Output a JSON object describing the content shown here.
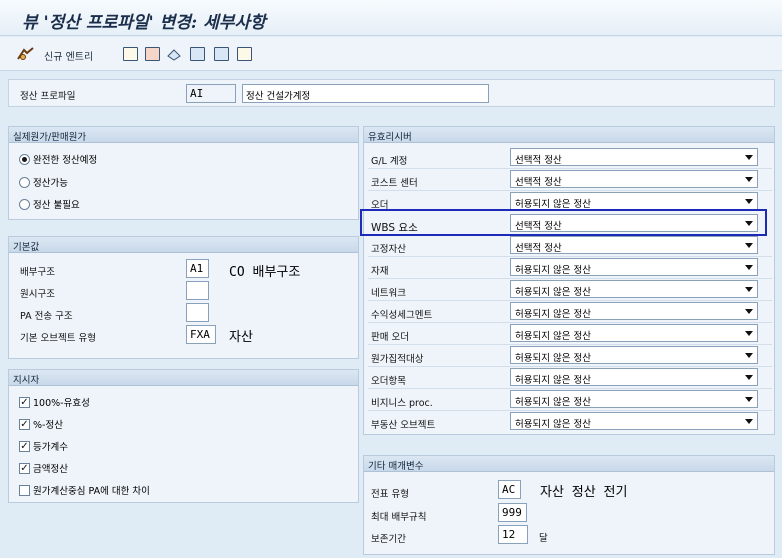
{
  "title": "뷰 '정산 프로파일' 변경: 세부사항",
  "toolbar": {
    "new_entries": "신규 엔트리",
    "icons": [
      "glasses-icon",
      "copy-icon",
      "delete-icon",
      "undo-icon",
      "previous-entry-icon",
      "next-entry-icon",
      "select-all-icon"
    ]
  },
  "header": {
    "profile_label": "정산 프로파일",
    "profile_code": "AI",
    "profile_desc": "정산 건설가계정"
  },
  "actual_costs": {
    "title": "실제원가/판매원가",
    "options": [
      {
        "label": "완전한 정산예정",
        "selected": true
      },
      {
        "label": "정산가능",
        "selected": false
      },
      {
        "label": "정산 불필요",
        "selected": false
      }
    ]
  },
  "defaults": {
    "title": "기본값",
    "rows": [
      {
        "label": "배부구조",
        "value": "A1",
        "desc": "CO 배부구조"
      },
      {
        "label": "원시구조",
        "value": "",
        "desc": ""
      },
      {
        "label": "PA 전송 구조",
        "value": "",
        "desc": ""
      },
      {
        "label": "기본 오브젝트 유형",
        "value": "FXA",
        "desc": "자산"
      }
    ]
  },
  "indicators": {
    "title": "지시자",
    "checks": [
      {
        "label": "100%-유효성",
        "checked": true
      },
      {
        "label": "%-정산",
        "checked": true
      },
      {
        "label": "등가계수",
        "checked": true
      },
      {
        "label": "금액정산",
        "checked": true
      },
      {
        "label": "원가계산중심 PA에 대한 차이",
        "checked": false
      }
    ]
  },
  "receivers": {
    "title": "유효리시버",
    "rows": [
      {
        "label": "G/L 계정",
        "value": "선택적 정산"
      },
      {
        "label": "코스트 센터",
        "value": "선택적 정산"
      },
      {
        "label": "오더",
        "value": "허용되지 않은 정산"
      },
      {
        "label": "WBS 요소",
        "value": "선택적 정산"
      },
      {
        "label": "고정자산",
        "value": "선택적 정산"
      },
      {
        "label": "자재",
        "value": "허용되지 않은 정산"
      },
      {
        "label": "네트워크",
        "value": "허용되지 않은 정산"
      },
      {
        "label": "수익성세그멘트",
        "value": "허용되지 않은 정산"
      },
      {
        "label": "판매 오더",
        "value": "허용되지 않은 정산"
      },
      {
        "label": "원가집적대상",
        "value": "허용되지 않은 정산"
      },
      {
        "label": "오더항목",
        "value": "허용되지 않은 정산"
      },
      {
        "label": "비지니스 proc.",
        "value": "허용되지 않은 정산"
      },
      {
        "label": "부동산 오브젝트",
        "value": "허용되지 않은 정산"
      }
    ],
    "highlighted_row": "WBS 요소"
  },
  "other_params": {
    "title": "기타 매개변수",
    "doc_type_label": "전표 유형",
    "doc_type_value": "AC",
    "doc_type_desc": "자산 정산 전기",
    "max_rules_label": "최대 배부규칙",
    "max_rules_value": "999",
    "retention_label": "보존기간",
    "retention_value": "12",
    "retention_unit": "달"
  },
  "colors": {
    "background": "#dfebf5",
    "group_header": "#c9d9ea",
    "focus_frame": "#1b2ab8"
  }
}
